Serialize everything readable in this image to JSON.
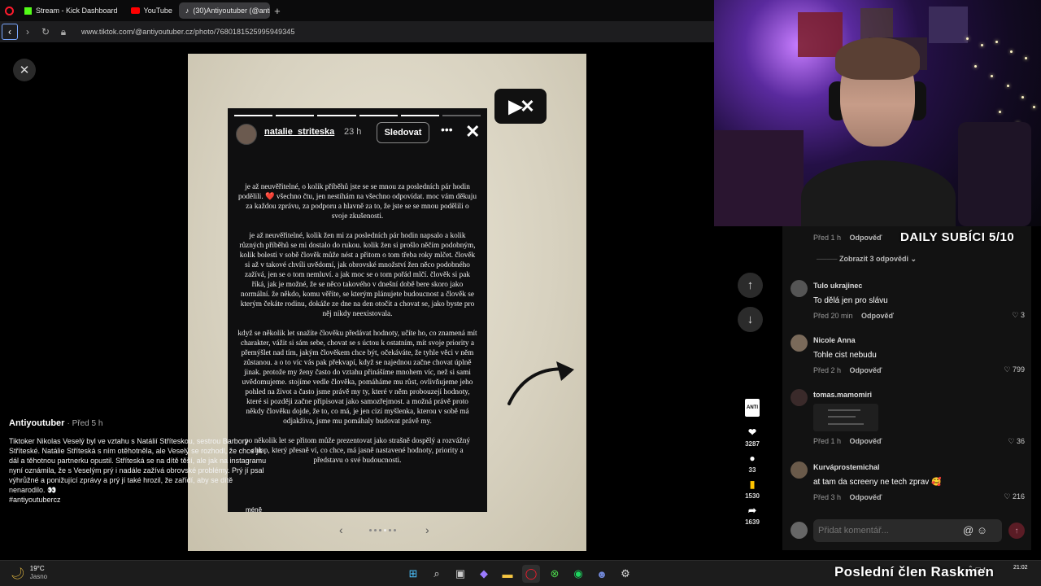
{
  "browser": {
    "tabs": [
      {
        "label": "Stream - Kick Dashboard",
        "favicon": "kick-icon"
      },
      {
        "label": "YouTube",
        "favicon": "youtube-icon"
      },
      {
        "label": "(30)Antiyoutuber (@anti",
        "favicon": "tiktok-icon",
        "active": true
      }
    ],
    "new_tab": "+",
    "url": "www.tiktok.com/@antiyoutuber.cz/photo/7680181525995949345"
  },
  "story": {
    "username": "natalie_striteska",
    "time": "23 h",
    "follow_label": "Sledovat",
    "paragraphs": [
      "je až neuvěřitelné, o kolik příběhů jste se se mnou za posledních pár hodin podělili. ❤️ všechno čtu, jen nestíhám na všechno odpovídat. moc vám děkuju za každou zprávu, za podporu a hlavně za to, že jste se se mnou podělili o svoje zkušenosti.",
      "je až neuvěřitelné, kolik žen mi za posledních pár hodin napsalo a kolik různých příběhů se mi dostalo do rukou. kolik žen si prošlo něčím podobným, kolik bolesti v sobě člověk může nést a přitom o tom třeba roky mlčet. člověk si až v takové chvíli uvědomí, jak obrovské množství žen něco podobného zažívá, jen se o tom nemluví. a jak moc se o tom pořád mlčí. člověk si pak říká, jak je možné, že se něco takového v dnešní době bere skoro jako normální. že někdo, komu věříte, se kterým plánujete budoucnost a člověk se kterým čekáte rodinu, dokáže ze dne na den otočit a chovat se, jako byste pro něj nikdy neexistovala.",
      "když se několik let snažíte člověku předávat hodnoty, učíte ho, co znamená mít charakter, vážit si sám sebe, chovat se s úctou k ostatním, mít svoje priority a přemýšlet nad tím, jakým člověkem chce být, očekáváte, že tyhle věci v něm zůstanou. a o to víc vás pak překvapí, když se najednou začne chovat úplně jinak. protože my ženy často do vztahu přinášíme mnohem víc, než si sami uvědomujeme. stojíme vedle člověka, pomáháme mu růst, ovlivňujeme jeho pohled na život a často jsme právě my ty, které v něm probouzejí hodnoty, které si později začne připisovat jako samozřejmost. a možná právě proto někdy člověku dojde, že to, co má, je jen cizí myšlenka, kterou v sobě má odjakživa, jsme mu pomáhaly budovat právě my.",
      "po několik let se přitom může prezentovat jako strašně dospělý a rozvážný chlap, který přesně ví, co chce, má jasně nastavené hodnoty, priority a představu o své budoucnosti."
    ],
    "more": "méně"
  },
  "post": {
    "author": "Antiyoutuber",
    "when": "· Před 5 h",
    "caption": "Tiktoker Nikolas Veselý byl ve vztahu s Natálií Stříteskou, sestrou Barbory Stříteské. Natálie Stříteská s ním otěhotněla, ale Veselý se rozhodl, že chce jít dál a těhotnou partnerku opustil. Stříteská se na dítě těší, ale jak na instagramu nyní oznámila, že s Veselým prý i nadále zažívá obrovské problémy. Prý jí psal výhrůžné a ponižující zprávy a prý jí také hrozil, že zařídí, aby se dítě nenarodilo. 👀",
    "hashtag": "#antiyoutubercz"
  },
  "actions": {
    "avatar_label": "ANTI",
    "likes": "3287",
    "comments": "33",
    "bookmarks": "1530",
    "shares": "1639"
  },
  "comments": {
    "top_meta": {
      "time": "Před 1 h",
      "reply": "Odpověď"
    },
    "view_replies": "Zobrazit 3 odpovědi",
    "items": [
      {
        "user": "Tulo ukrajinec",
        "text": "To dělá jen pro slávu",
        "time": "Před 20 min",
        "reply": "Odpověď",
        "likes": "3"
      },
      {
        "user": "Nicole Anna",
        "text": "Tohle cist nebudu",
        "time": "Před 2 h",
        "reply": "Odpověď",
        "likes": "799"
      },
      {
        "user": "tomas.mamomiri",
        "text": "",
        "time": "Před 1 h",
        "reply": "Odpověď",
        "likes": "36"
      },
      {
        "user": "Kurváprostemichal",
        "text": "at tam da screeny ne tech zprav 🥰",
        "time": "Před 3 h",
        "reply": "Odpověď",
        "likes": "216"
      }
    ],
    "input_placeholder": "Přidat komentář..."
  },
  "overlay": {
    "subs_label": "DAILY SUBÍCI 5/10",
    "ticker": "Poslední člen Raskmen"
  },
  "taskbar": {
    "temp": "19°C",
    "weather_desc": "Jasno",
    "time": "21:02"
  },
  "colors": {
    "accent": "#fe2c55",
    "bookmark": "#ffc400",
    "browser_brand": "#ff1b2d"
  }
}
